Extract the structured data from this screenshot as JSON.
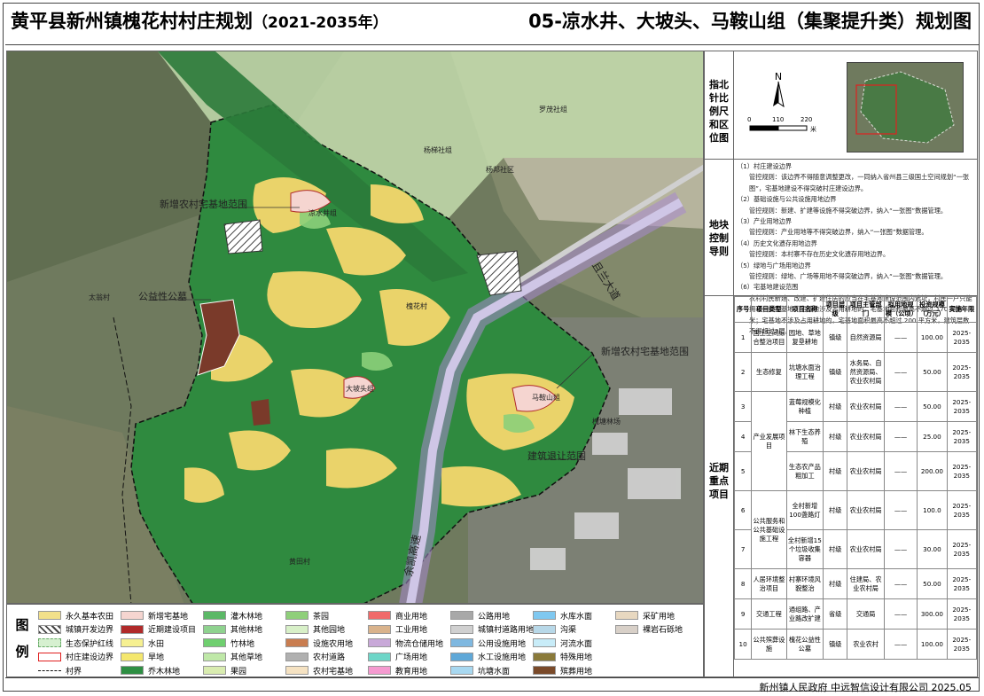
{
  "title": {
    "main": "黄平县新州镇槐花村村庄规划",
    "years": "（2021-2035年）",
    "sheet": "05-凉水井、大坡头、马鞍山组（集聚提升类）规划图"
  },
  "map_labels": {
    "homestead_top": "新增农村宅基地范围",
    "public_cemetery": "公益性公墓",
    "homestead_right": "新增农村宅基地范围",
    "relocation": "建筑退让范围",
    "road": "且兰大道",
    "highway": "余凯高速",
    "village_main": "槐花村",
    "village_taiyong": "太翁村",
    "village_huangtian": "黄田村",
    "group_liangshuijing": "凉水井组",
    "group_dapotou": "大坡头组",
    "group_maanshan": "马鞍山组",
    "village_luomao": "罗茂社组",
    "village_yangbang": "杨邦社区",
    "village_yangbang2": "杨梯社组",
    "village_laowei": "槐塘林场"
  },
  "legend": {
    "title": "图例",
    "items": [
      {
        "label": "永久基本农田",
        "color": "#f2e08a"
      },
      {
        "label": "城镇开发边界",
        "color": "#9a9a9a"
      },
      {
        "label": "生态保护红线",
        "color": "#d6f0d0"
      },
      {
        "label": "村庄建设边界",
        "color": "#ffffff"
      },
      {
        "label": "村界",
        "color": "#ffffff"
      },
      {
        "label": "新增宅基地",
        "color": "#f5d5d0"
      },
      {
        "label": "近期建设项目",
        "color": "#b02a2a"
      },
      {
        "label": "水田",
        "color": "#f6f091"
      },
      {
        "label": "旱地",
        "color": "#f4e76e"
      },
      {
        "label": "乔木林地",
        "color": "#2e8f43"
      },
      {
        "label": "灌木林地",
        "color": "#5bb866"
      },
      {
        "label": "其他林地",
        "color": "#8fd28f"
      },
      {
        "label": "竹林地",
        "color": "#6fcf6f"
      },
      {
        "label": "其他草地",
        "color": "#bfe8a8"
      },
      {
        "label": "果园",
        "color": "#d9ecb0"
      },
      {
        "label": "茶园",
        "color": "#8fcf7a"
      },
      {
        "label": "其他园地",
        "color": "#d8f0c8"
      },
      {
        "label": "设施农用地",
        "color": "#c97d50"
      },
      {
        "label": "农村道路",
        "color": "#b0b0b0"
      },
      {
        "label": "农村宅基地",
        "color": "#f5e2c2"
      },
      {
        "label": "商业用地",
        "color": "#f06a6a"
      },
      {
        "label": "工业用地",
        "color": "#d9b38c"
      },
      {
        "label": "物流仓储用地",
        "color": "#c8a8d8"
      },
      {
        "label": "广场用地",
        "color": "#6ed6c8"
      },
      {
        "label": "教育用地",
        "color": "#f59ad0"
      },
      {
        "label": "公路用地",
        "color": "#a8a8a8"
      },
      {
        "label": "城镇村道路用地",
        "color": "#d0d0d0"
      },
      {
        "label": "公用设施用地",
        "color": "#7fb8e0"
      },
      {
        "label": "水工设施用地",
        "color": "#5fa8d8"
      },
      {
        "label": "坑塘水面",
        "color": "#a8d8f0"
      },
      {
        "label": "水库水面",
        "color": "#7fc8f0"
      },
      {
        "label": "沟渠",
        "color": "#b8d8e8"
      },
      {
        "label": "河流水面",
        "color": "#c8ecf8"
      },
      {
        "label": "特殊用地",
        "color": "#8a7a3a"
      },
      {
        "label": "殡葬用地",
        "color": "#7a4a2a"
      },
      {
        "label": "采矿用地",
        "color": "#e8d8c0"
      },
      {
        "label": "裸岩石砾地",
        "color": "#d8d0c8"
      }
    ]
  },
  "panel": {
    "compass_label": "指北针比例尺和区位图",
    "scale": {
      "t0": "0",
      "t1": "110",
      "t2": "220",
      "unit": "米"
    },
    "north": "N",
    "control_label": "地块控制导则",
    "rules": [
      {
        "head": "（1）村庄建设边界",
        "body": "管控规则：该边界不得随意调整更改，一同纳入省州县三级国土空间规划“一张图”，宅基地建设不得突破村庄建设边界。"
      },
      {
        "head": "（2）基础设施与公共设施用地边界",
        "body": "管控规则：新建、扩建等设施不得突破边界，纳入“一张图”数据管理。"
      },
      {
        "head": "（3）产业用地边界",
        "body": "管控规则：产业用地等不得突破边界，纳入“一张图”数据管理。"
      },
      {
        "head": "（4）历史文化遗存用地边界",
        "body": "管控规则：本村寨不存在历史文化遗存用地边界。"
      },
      {
        "head": "（5）绿地与广场用地边界",
        "body": "管控规则：绿地、广场等用地不得突破边界，纳入“一张图”数据管理。"
      },
      {
        "head": "（6）宅基地建设范围",
        "body": "农村村民新建、改建、扩建住房的应当在宅基地建设范围内选址，村民一户只能拥有一处宅基地。宅基地涉及占用耕地的，宅基地面积最高不超过 170 平方米；宅基地不涉及占用耕地的，宅基地面积最高不超过 200 平方米，建筑层数不得超过3层。"
      }
    ],
    "projects_label": "近期重点项目",
    "table_headers": [
      "序号",
      "项目类型",
      "项目名称",
      "项目层级",
      "项目主管部门",
      "拟用地规模（公顷）",
      "投资规模（万元）",
      "实施年限"
    ],
    "rows": [
      {
        "no": "1",
        "type": "国土空间综合整治项目",
        "name": "园地、草地复垦耕地",
        "level": "镇级",
        "dept": "自然资源局",
        "area": "——",
        "invest": "100.00",
        "years": "2025-2035"
      },
      {
        "no": "2",
        "type": "生态修复",
        "name": "坑塘水面治理工程",
        "level": "镇级",
        "dept": "水务局、自然资源局、农业农村局",
        "area": "——",
        "invest": "50.00",
        "years": "2025-2035"
      },
      {
        "no": "3",
        "type": "产业发展项目",
        "name": "蓝莓规模化种植",
        "level": "村级",
        "dept": "农业农村局",
        "area": "——",
        "invest": "50.00",
        "years": "2025-2035"
      },
      {
        "no": "4",
        "type": "",
        "name": "林下生态养殖",
        "level": "村级",
        "dept": "农业农村局",
        "area": "——",
        "invest": "25.00",
        "years": "2025-2035"
      },
      {
        "no": "5",
        "type": "",
        "name": "生态农产品粗加工",
        "level": "村级",
        "dept": "农业农村局",
        "area": "——",
        "invest": "200.00",
        "years": "2025-2035"
      },
      {
        "no": "6",
        "type": "公共服务和公共基础设施工程",
        "name": "全村新增100盏路灯",
        "level": "村级",
        "dept": "农业农村局",
        "area": "——",
        "invest": "100.0",
        "years": "2025-2035"
      },
      {
        "no": "7",
        "type": "",
        "name": "全村新增15个垃圾收集容器",
        "level": "村级",
        "dept": "农业农村局",
        "area": "——",
        "invest": "30.00",
        "years": "2025-2035"
      },
      {
        "no": "8",
        "type": "人居环境整治项目",
        "name": "村寨环境风貌整治",
        "level": "村级",
        "dept": "住建局、农业农村局",
        "area": "——",
        "invest": "50.00",
        "years": "2025-2035"
      },
      {
        "no": "9",
        "type": "交通工程",
        "name": "通组路、产业路改扩建",
        "level": "省级",
        "dept": "交通局",
        "area": "——",
        "invest": "300.00",
        "years": "2025-2035"
      },
      {
        "no": "10",
        "type": "公共殡葬设施",
        "name": "槐花公益性公墓",
        "level": "镇级",
        "dept": "农业农村",
        "area": "——",
        "invest": "100.00",
        "years": "2025-2035"
      }
    ]
  },
  "footer": "新州镇人民政府   中远智信设计有限公司  2025.05"
}
